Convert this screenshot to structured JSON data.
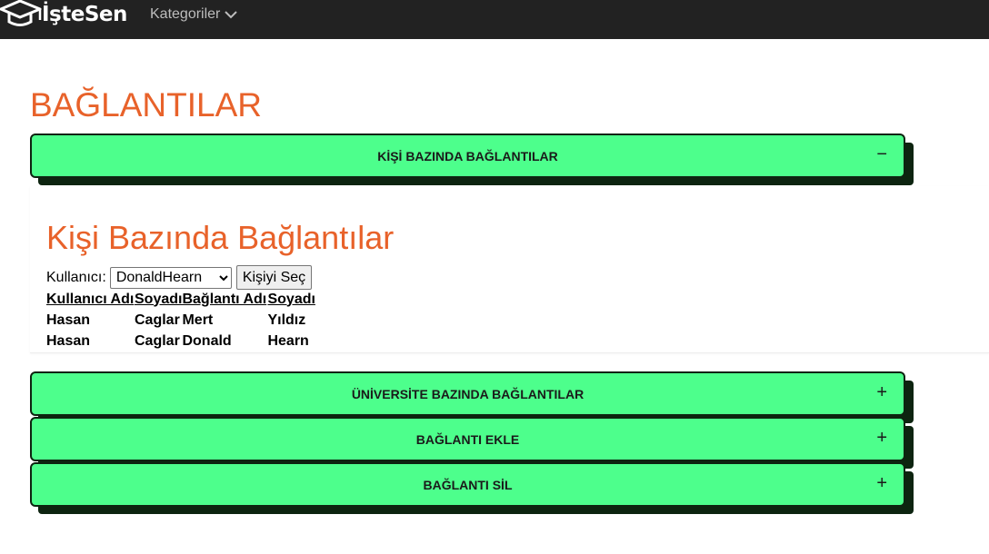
{
  "nav": {
    "brand": "İşteSen",
    "categories": "Kategoriler"
  },
  "page": {
    "title": "BAĞLANTILAR"
  },
  "accordion": [
    {
      "label": "KİŞİ BAZINDA BAĞLANTILAR",
      "sign": "−"
    },
    {
      "label": "ÜNİVERSİTE BAZINDA BAĞLANTILAR",
      "sign": "+"
    },
    {
      "label": "BAĞLANTI EKLE",
      "sign": "+"
    },
    {
      "label": "BAĞLANTI SİL",
      "sign": "+"
    }
  ],
  "panel": {
    "title": "Kişi Bazında Bağlantılar",
    "user_label": "Kullanıcı:",
    "selected_user": "DonaldHearn",
    "select_button": "Kişiyi Seç",
    "columns": [
      "Kullanıcı Adı",
      "Soyadı",
      "Bağlantı Adı",
      "Soyadı"
    ],
    "rows": [
      [
        "Hasan",
        "Caglar",
        "Mert",
        "Yıldız"
      ],
      [
        "Hasan",
        "Caglar",
        "Donald",
        "Hearn"
      ]
    ]
  }
}
